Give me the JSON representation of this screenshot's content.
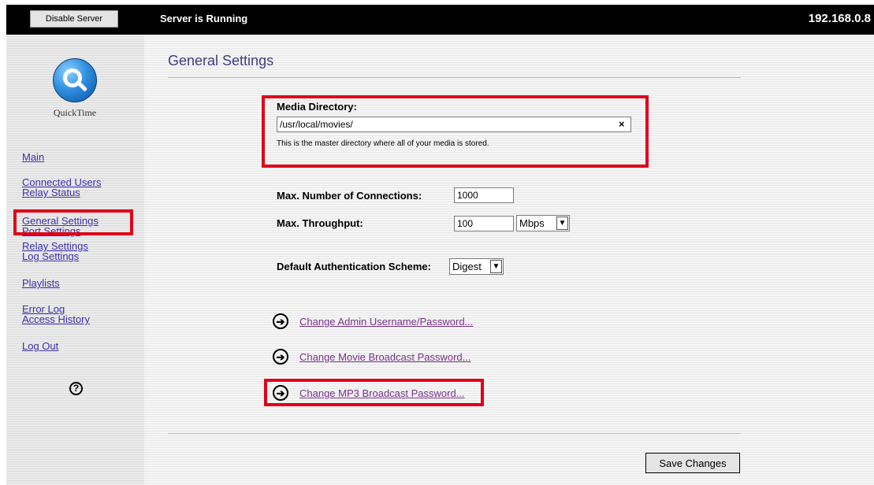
{
  "topbar": {
    "disable_button": "Disable Server",
    "status": "Server is Running",
    "ip_address": "192.168.0.8"
  },
  "logo": {
    "text": "QuickTime"
  },
  "nav": {
    "main": "Main",
    "connected_users": "Connected Users",
    "relay_status": "Relay Status",
    "general_settings": "General Settings",
    "port_settings": "Port Settings",
    "relay_settings": "Relay Settings",
    "log_settings": "Log Settings",
    "playlists": "Playlists",
    "error_log": "Error Log",
    "access_history": "Access History",
    "log_out": "Log Out",
    "help_glyph": "?"
  },
  "page": {
    "title": "General Settings",
    "media_directory": {
      "label": "Media Directory:",
      "value": "/usr/local/movies/",
      "clear_glyph": "×",
      "help": "This is the master directory where all of your media is stored."
    },
    "max_connections": {
      "label": "Max. Number of Connections:",
      "value": "1000"
    },
    "max_throughput": {
      "label": "Max. Throughput:",
      "value": "100",
      "unit": "Mbps"
    },
    "auth_scheme": {
      "label": "Default Authentication Scheme:",
      "value": "Digest"
    },
    "links": {
      "admin": "Change Admin Username/Password...",
      "movie_broadcast": "Change Movie Broadcast Password...",
      "mp3_broadcast": "Change MP3 Broadcast Password..."
    },
    "save_button": "Save Changes"
  },
  "icons": {
    "arrow": "arrow-right-circle-icon",
    "help": "help-icon",
    "dropdown": "chevron-down-icon"
  },
  "colors": {
    "highlight": "#e0001a",
    "link": "#3a2fb0",
    "visited_link": "#7a2f8c",
    "title": "#3c3c8a"
  }
}
